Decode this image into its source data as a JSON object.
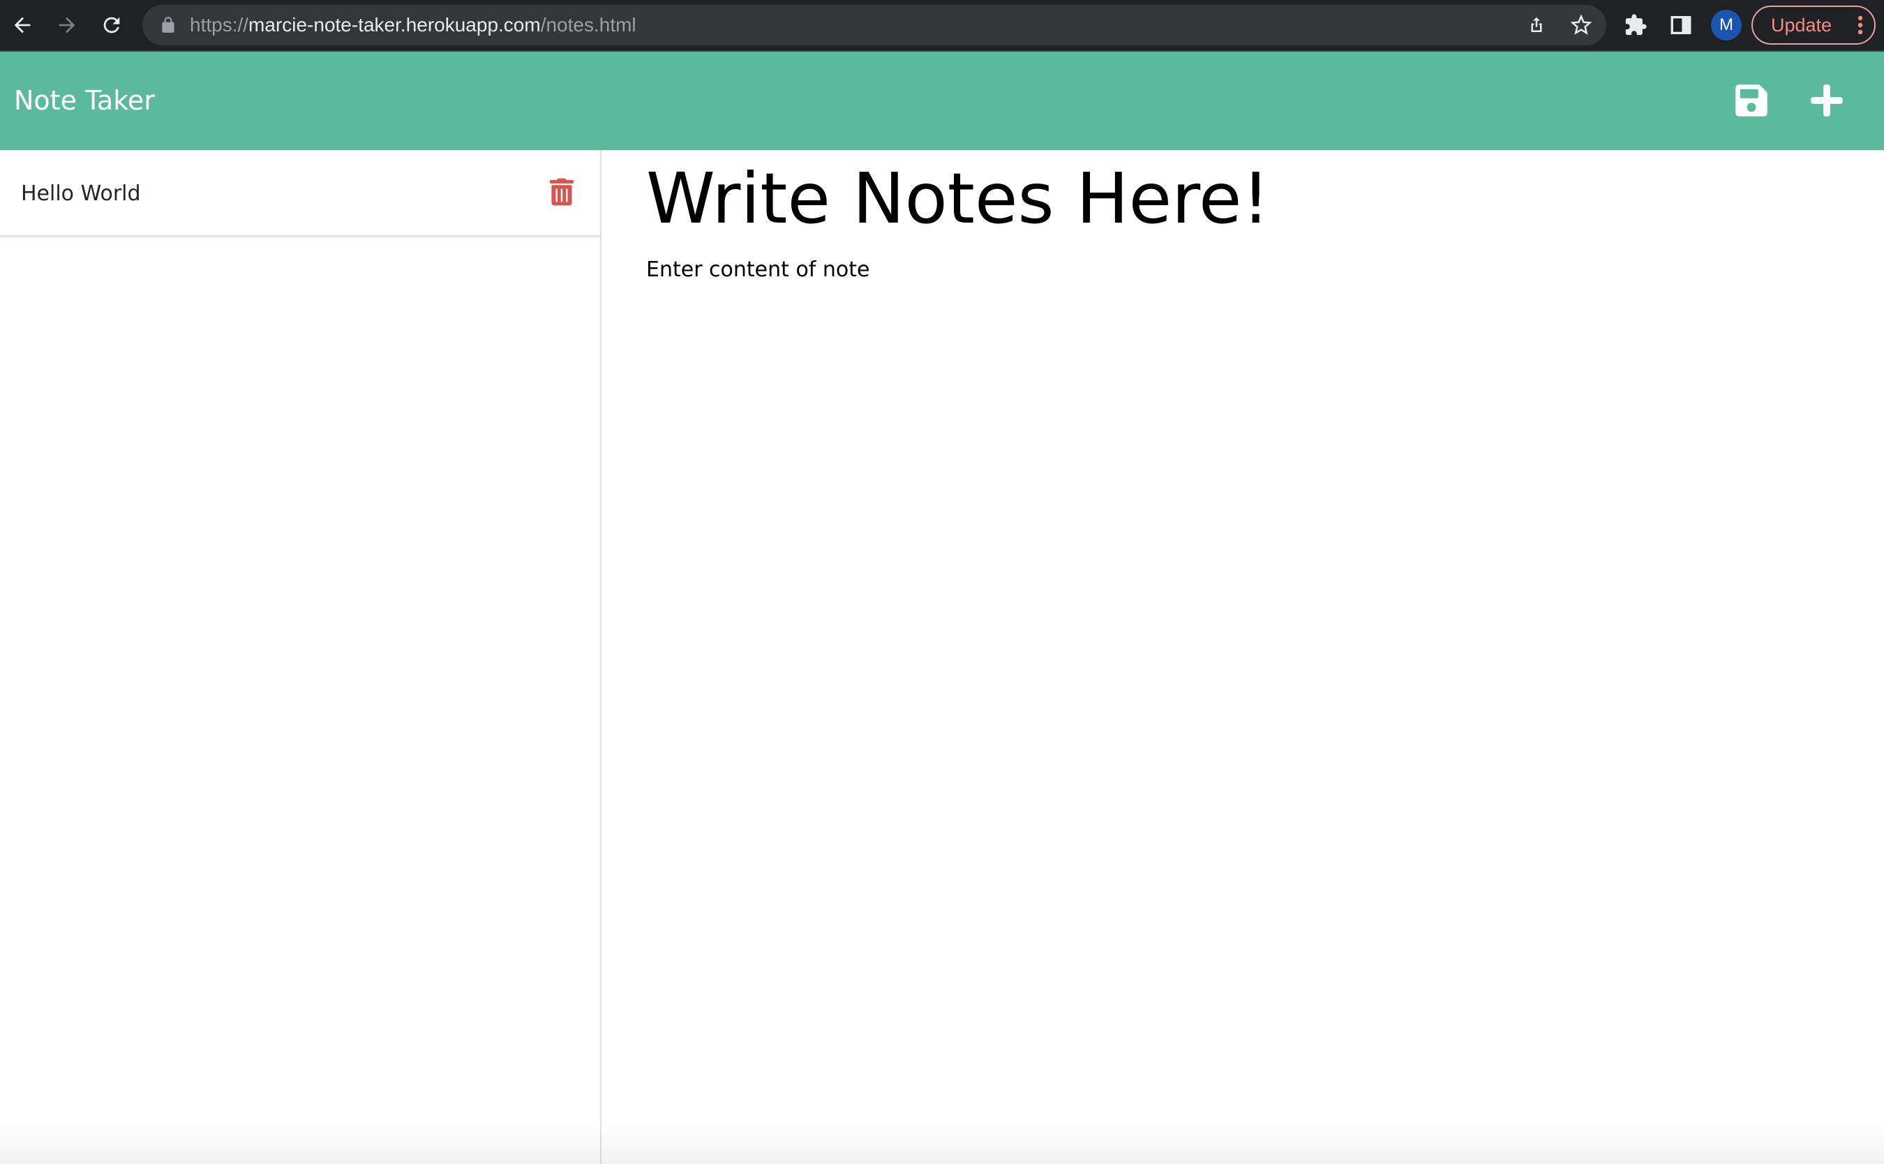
{
  "browser": {
    "url_scheme": "https://",
    "url_host": "marcie-note-taker.herokuapp.com",
    "url_path": "/notes.html",
    "profile_initial": "M",
    "update_label": "Update"
  },
  "navbar": {
    "brand": "Note Taker",
    "save_icon": "floppy-disk",
    "new_icon": "plus"
  },
  "sidebar": {
    "notes": [
      {
        "title": "Hello World",
        "delete_icon": "trash-can"
      }
    ]
  },
  "editor": {
    "title_placeholder": "Write Notes Here!",
    "title_value": "",
    "text_value": "Enter content of note"
  },
  "colors": {
    "navbar_bg": "#5bba9c",
    "delete_icon": "#d9534f",
    "browser_bg": "#202124"
  }
}
